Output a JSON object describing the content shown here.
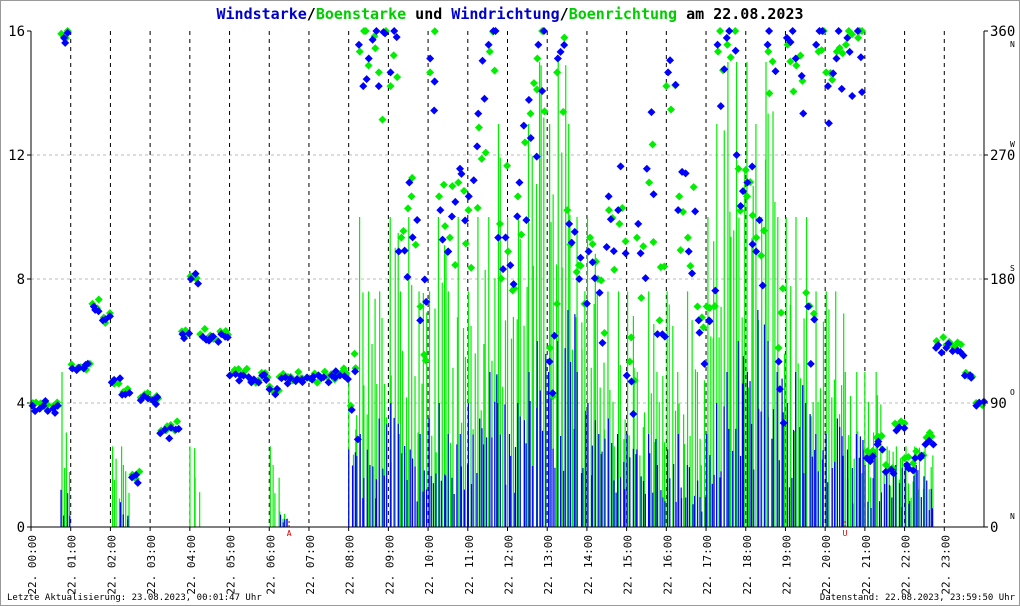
{
  "title": {
    "part1": "Windstarke",
    "sep1": "/",
    "part2": "Boenstarke",
    "mid": " und ",
    "part3": "Windrichtung",
    "sep2": "/",
    "part4": "Boenrichtung",
    "date": " am 22.08.2023"
  },
  "footer": {
    "left": "Letzte Aktualisierung: 23.08.2023, 00:01:47 Uhr",
    "right": "Datenstand: 22.08.2023, 23:59:50 Uhr"
  },
  "colors": {
    "wind": "#0000ff",
    "gust": "#00ee00",
    "marker": "#dd0000"
  },
  "chart_data": {
    "type": "bar+scatter",
    "title": "Windstarke/Boenstarke und Windrichtung/Boenrichtung am 22.08.2023",
    "x_ticks": [
      "22. 00:00",
      "22. 01:00",
      "22. 02:00",
      "22. 03:00",
      "22. 04:00",
      "22. 05:00",
      "22. 06:00",
      "22. 07:00",
      "22. 08:00",
      "22. 09:00",
      "22. 10:00",
      "22. 11:00",
      "22. 12:00",
      "22. 13:00",
      "22. 14:00",
      "22. 15:00",
      "22. 16:00",
      "22. 17:00",
      "22. 18:00",
      "22. 19:00",
      "22. 20:00",
      "22. 21:00",
      "22. 22:00",
      "22. 23:00"
    ],
    "left_axis": {
      "ylim": [
        0,
        16
      ],
      "ticks": [
        "0",
        "4",
        "8",
        "12",
        "16"
      ]
    },
    "right_axis": {
      "ylim": [
        0,
        360
      ],
      "ticks": [
        "0",
        "90",
        "180",
        "270",
        "360"
      ],
      "compass": [
        "N",
        "O",
        "S",
        "W",
        "N"
      ]
    },
    "markers": [
      {
        "hour": 6.5,
        "label": "A"
      },
      {
        "hour": 20.5,
        "label": "U"
      }
    ],
    "interval_minutes": 15,
    "series": [
      {
        "name": "Windstarke",
        "kind": "bar",
        "values": [
          0,
          0,
          0,
          1.2,
          0,
          0,
          0,
          0,
          0,
          0.8,
          0,
          0,
          0,
          0,
          0,
          0,
          0,
          0,
          0,
          0,
          0,
          0,
          0,
          0,
          0,
          0.4,
          0,
          0,
          0,
          0,
          0,
          0,
          2.5,
          3,
          2,
          3.5,
          4,
          3,
          2.5,
          3,
          3.5,
          4,
          3,
          3,
          4,
          3.5,
          5,
          4,
          3,
          4,
          5,
          6,
          5,
          6,
          7,
          5,
          4,
          3,
          3.5,
          3,
          3,
          2.5,
          3,
          2,
          2.5,
          3,
          2,
          1.5,
          3,
          4,
          5,
          6,
          5,
          7,
          6,
          5,
          4,
          5,
          4,
          3,
          3,
          3.5,
          2.5,
          3,
          2,
          2.5,
          2,
          2,
          2,
          2,
          1.5,
          0,
          0,
          0,
          0,
          0
        ]
      },
      {
        "name": "Boenstarke",
        "kind": "bar",
        "values": [
          0,
          0,
          0,
          5,
          0,
          0,
          0,
          0,
          2.6,
          2.6,
          0,
          0,
          0,
          0,
          0,
          0,
          2.6,
          0,
          0,
          0,
          0,
          0,
          0,
          0,
          2.6,
          0.5,
          0,
          0,
          0,
          0,
          0,
          0,
          5,
          10,
          7.6,
          7.6,
          10,
          7.6,
          10,
          7.6,
          7.6,
          10,
          7.6,
          10,
          7.6,
          10,
          10,
          13,
          10,
          10,
          13,
          15,
          13,
          15,
          13,
          10,
          10,
          7.6,
          7.6,
          7.6,
          7.6,
          5,
          7.6,
          5,
          7.6,
          5,
          7.6,
          5,
          10,
          13,
          15,
          15,
          15,
          13,
          15,
          10,
          10,
          10,
          10,
          7.6,
          7.6,
          7.6,
          5,
          5,
          5,
          5,
          2.6,
          2.6,
          2.6,
          2.6,
          2.6,
          0,
          0,
          0,
          0,
          0
        ]
      },
      {
        "name": "Windrichtung",
        "kind": "scatter",
        "values": [
          88,
          88,
          86,
          355,
          115,
          115,
          160,
          150,
          105,
          96,
          36,
          92,
          92,
          68,
          72,
          140,
          180,
          138,
          138,
          140,
          110,
          110,
          105,
          110,
          100,
          108,
          108,
          107,
          107,
          108,
          110,
          110,
          85,
          350,
          340,
          320,
          330,
          200,
          250,
          150,
          340,
          230,
          200,
          260,
          240,
          300,
          350,
          210,
          190,
          250,
          310,
          350,
          120,
          340,
          220,
          180,
          200,
          170,
          240,
          230,
          110,
          220,
          260,
          140,
          330,
          230,
          200,
          150,
          150,
          350,
          355,
          270,
          250,
          200,
          350,
          120,
          355,
          340,
          160,
          350,
          320,
          340,
          355,
          360,
          50,
          60,
          40,
          70,
          45,
          50,
          60,
          130,
          130,
          128,
          110,
          88
        ]
      },
      {
        "name": "Boenrichtung",
        "kind": "scatter",
        "values": [
          90,
          88,
          88,
          358,
          118,
          116,
          162,
          152,
          106,
          98,
          38,
          94,
          93,
          70,
          74,
          142,
          182,
          140,
          139,
          142,
          112,
          111,
          106,
          112,
          102,
          109,
          109,
          108,
          108,
          109,
          111,
          112,
          88,
          345,
          335,
          330,
          320,
          210,
          240,
          160,
          330,
          240,
          210,
          250,
          230,
          290,
          345,
          220,
          200,
          240,
          300,
          340,
          130,
          330,
          230,
          190,
          210,
          180,
          230,
          220,
          120,
          210,
          250,
          150,
          320,
          240,
          210,
          160,
          160,
          345,
          350,
          260,
          240,
          210,
          345,
          130,
          350,
          335,
          170,
          345,
          330,
          345,
          350,
          355,
          55,
          65,
          45,
          75,
          50,
          55,
          65,
          135,
          132,
          130,
          112,
          90
        ]
      }
    ]
  }
}
